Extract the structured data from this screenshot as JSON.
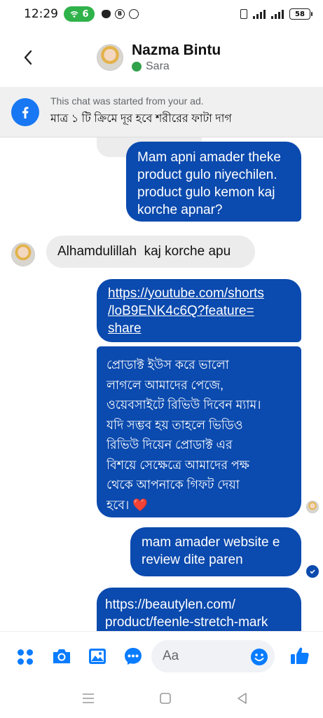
{
  "status_bar": {
    "time": "12:29",
    "hotspot_count": "6",
    "battery": "58"
  },
  "header": {
    "contact_name": "Nazma Bintu",
    "contact_sub": "Sara"
  },
  "ad_banner": {
    "note": "This chat was started from your ad.",
    "title": "মাত্র ১ টি ক্রিমে দূর হবে শরীরের ফাটা দাগ"
  },
  "messages": [
    {
      "side": "out",
      "lines": [
        "Mam apni amader theke",
        "product gulo niyechilen.",
        "product gulo kemon kaj",
        "korche apnar?"
      ]
    },
    {
      "side": "in",
      "text": "Alhamdulillah  kaj korche apu"
    },
    {
      "side": "out",
      "link_lines": [
        "https://youtube.com/shorts",
        "/loB9ENK4c6Q?feature=",
        "share"
      ]
    },
    {
      "side": "out",
      "lines": [
        "প্রোডাক্ট ইউস করে ভালো",
        "লাগলে আমাদের পেজে,",
        "ওয়েবসাইটে রিভিউ দিবেন ম্যাম।",
        "যদি সম্ভব হয় তাহলে ভিডিও",
        "রিভিউ দিয়েন প্রোডাক্ট এর",
        "বিশয়ে সেক্ষেত্রে আমাদের পক্ষ",
        "থেকে আপনাকে গিফট দেয়া",
        "হবে। ❤️"
      ]
    },
    {
      "side": "out",
      "lines": [
        "mam amader website e",
        "review dite paren"
      ]
    },
    {
      "side": "out",
      "lines": [
        "https://beautylen.com/",
        "product/feenle-stretch-mark"
      ]
    }
  ],
  "composer": {
    "placeholder": "Aa"
  },
  "colors": {
    "outgoing_bubble": "#0b4aae",
    "incoming_bubble": "#ececec",
    "messenger_blue": "#1877f2",
    "online_green": "#31a24c"
  },
  "icons": [
    "chevron-left-icon",
    "facebook-icon",
    "menu-grid-icon",
    "camera-icon",
    "image-icon",
    "chat-bubble-icon",
    "emoji-icon",
    "thumbs-up-icon",
    "nav-menu-icon",
    "nav-home-icon",
    "nav-back-icon"
  ]
}
